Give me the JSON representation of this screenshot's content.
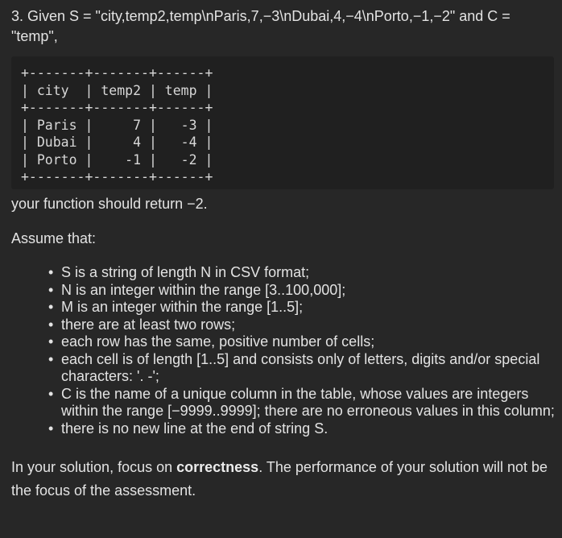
{
  "intro": "3. Given S = \"city,temp2,temp\\nParis,7,−3\\nDubai,4,−4\\nPorto,−1,−2\" and C = \"temp\",",
  "table_ascii": "+-------+-------+------+\n| city  | temp2 | temp |\n+-------+-------+------+\n| Paris |     7 |   -3 |\n| Dubai |     4 |   -4 |\n| Porto |    -1 |   -2 |\n+-------+-------+------+",
  "return_text": "your function should return −2.",
  "assume_heading": "Assume that:",
  "bullets": [
    "S is a string of length N in CSV format;",
    "N is an integer within the range [3..100,000];",
    "M is an integer within the range [1..5];",
    "there are at least two rows;",
    "each row has the same, positive number of cells;",
    "each cell is of length [1..5] and consists only of letters, digits and/or special characters: '. -';",
    "C is the name of a unique column in the table, whose values are integers within the range [−9999..9999]; there are no erroneous values in this column;",
    "there is no new line at the end of string S."
  ],
  "focus": {
    "before": "In your solution, focus on ",
    "bold": "correctness",
    "after": ". The performance of your solution will not be the focus of the assessment."
  }
}
